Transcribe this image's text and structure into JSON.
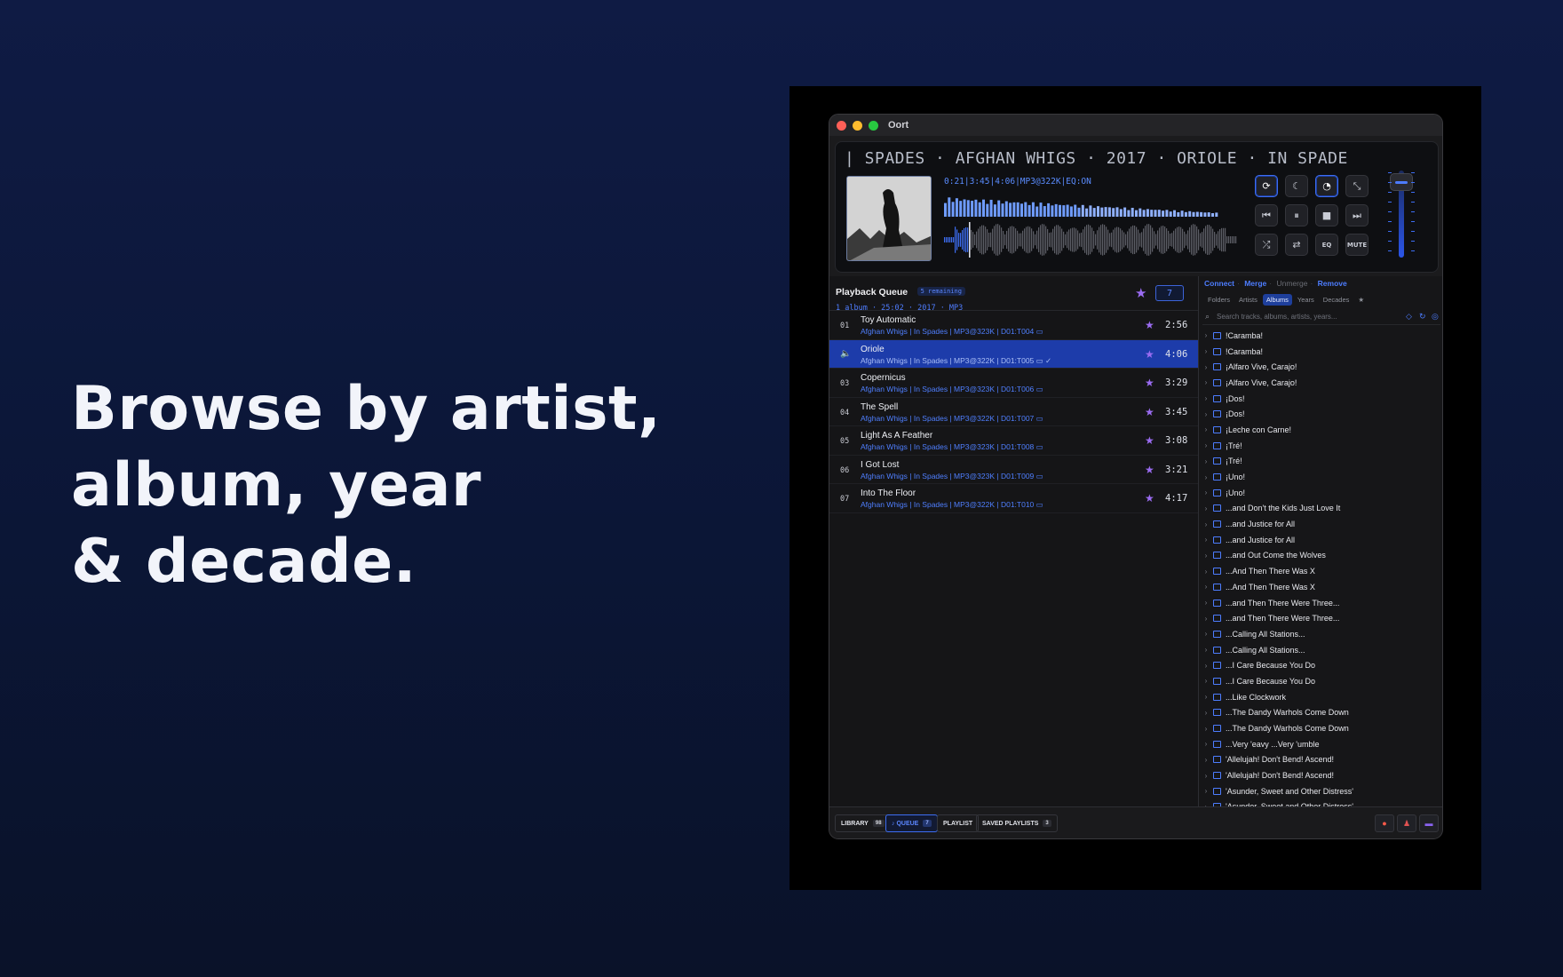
{
  "headline": {
    "line1": "Browse by artist,",
    "line2": "album, year",
    "line3": "& decade."
  },
  "window": {
    "title": "Oort"
  },
  "player": {
    "marquee": "| SPADES  ·  AFGHAN WHIGS  ·  2017  ·  ORIOLE  ·  IN SPADE",
    "status": "0:21|3:45|4:06|MP3@322K|EQ:ON",
    "buttons": {
      "eq": "EQ",
      "mute": "MUTE"
    },
    "progress": 0.085,
    "volume": 0.85
  },
  "queue": {
    "title": "Playback Queue",
    "badge": "5 remaining",
    "summary": "1 album · 25:02 · 2017 · MP3",
    "count": "7",
    "rows": [
      {
        "num": "01",
        "title": "Toy Automatic",
        "meta": "Afghan Whigs | In Spades | MP3@323K | D01:T004 ▭",
        "time": "2:56"
      },
      {
        "num": "",
        "title": "Oriole",
        "meta": "Afghan Whigs | In Spades | MP3@322K | D01:T005 ▭ ✓",
        "time": "4:06"
      },
      {
        "num": "03",
        "title": "Copernicus",
        "meta": "Afghan Whigs | In Spades | MP3@323K | D01:T006 ▭",
        "time": "3:29"
      },
      {
        "num": "04",
        "title": "The Spell",
        "meta": "Afghan Whigs | In Spades | MP3@322K | D01:T007 ▭",
        "time": "3:45"
      },
      {
        "num": "05",
        "title": "Light As A Feather",
        "meta": "Afghan Whigs | In Spades | MP3@323K | D01:T008 ▭",
        "time": "3:08"
      },
      {
        "num": "06",
        "title": "I Got Lost",
        "meta": "Afghan Whigs | In Spades | MP3@323K | D01:T009 ▭",
        "time": "3:21"
      },
      {
        "num": "07",
        "title": "Into The Floor",
        "meta": "Afghan Whigs | In Spades | MP3@322K | D01:T010 ▭",
        "time": "4:17"
      }
    ]
  },
  "library": {
    "actions": {
      "connect": "Connect",
      "merge": "Merge",
      "unmerge": "Unmerge",
      "remove": "Remove"
    },
    "tabs": {
      "folders": "Folders",
      "artists": "Artists",
      "albums": "Albums",
      "years": "Years",
      "decades": "Decades",
      "star": "★"
    },
    "search_placeholder": "Search tracks, albums, artists, years...",
    "items": [
      "!Caramba!",
      "!Caramba!",
      "¡Alfaro Vive, Carajo!",
      "¡Alfaro Vive, Carajo!",
      "¡Dos!",
      "¡Dos!",
      "¡Leche con Carne!",
      "¡Tré!",
      "¡Tré!",
      "¡Uno!",
      "¡Uno!",
      "...and Don't the Kids Just Love It",
      "...and Justice for All",
      "...and Justice for All",
      "...and Out Come the Wolves",
      "...And Then There Was X",
      "...And Then There Was X",
      "...and Then There Were Three...",
      "...and Then There Were Three...",
      "...Calling All Stations...",
      "...Calling All Stations...",
      "...I Care Because You Do",
      "...I Care Because You Do",
      "...Like Clockwork",
      "...The Dandy Warhols Come Down",
      "...The Dandy Warhols Come Down",
      "...Very 'eavy ...Very 'umble",
      "'Allelujah! Don't Bend! Ascend!",
      "'Allelujah! Don't Bend! Ascend!",
      "'Asunder, Sweet and Other Distress'",
      "'Asunder, Sweet and Other Distress'"
    ]
  },
  "footer": {
    "library": {
      "label": "LIBRARY",
      "count": "98"
    },
    "queue": {
      "label": "♪ QUEUE",
      "count": "7"
    },
    "playlist": {
      "label": "PLAYLIST"
    },
    "saved": {
      "label": "SAVED PLAYLISTS",
      "count": "3"
    }
  },
  "colors": {
    "accent": "#3d6df2",
    "star": "#9b6cf2",
    "active_row": "#1d3caa"
  }
}
